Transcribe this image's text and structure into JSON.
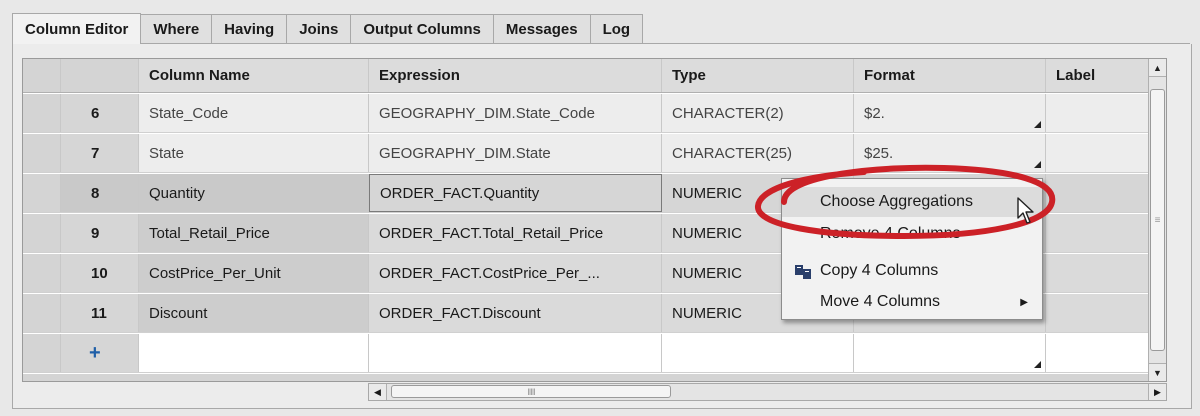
{
  "tabs": [
    {
      "label": "Column Editor",
      "active": true
    },
    {
      "label": "Where"
    },
    {
      "label": "Having"
    },
    {
      "label": "Joins"
    },
    {
      "label": "Output Columns"
    },
    {
      "label": "Messages"
    },
    {
      "label": "Log"
    }
  ],
  "grid": {
    "headers": [
      "",
      "Column Name",
      "Expression",
      "Type",
      "Format",
      "Label"
    ],
    "rows": [
      {
        "num": "6",
        "name": "State_Code",
        "expression": "GEOGRAPHY_DIM.State_Code",
        "type": "CHARACTER(2)",
        "format": "$2.",
        "label": ""
      },
      {
        "num": "7",
        "name": "State",
        "expression": "GEOGRAPHY_DIM.State",
        "type": "CHARACTER(25)",
        "format": "$25.",
        "label": ""
      },
      {
        "num": "8",
        "name": "Quantity",
        "expression": "ORDER_FACT.Quantity",
        "type": "NUMERIC",
        "format": "",
        "label": ""
      },
      {
        "num": "9",
        "name": "Total_Retail_Price",
        "expression": "ORDER_FACT.Total_Retail_Price",
        "type": "NUMERIC",
        "format": "",
        "label": ""
      },
      {
        "num": "10",
        "name": "CostPrice_Per_Unit",
        "expression": "ORDER_FACT.CostPrice_Per_...",
        "type": "NUMERIC",
        "format": "",
        "label": ""
      },
      {
        "num": "11",
        "name": "Discount",
        "expression": "ORDER_FACT.Discount",
        "type": "NUMERIC",
        "format": "",
        "label": ""
      }
    ],
    "add_row_symbol": "+"
  },
  "context_menu": {
    "items": [
      {
        "label": "Choose Aggregations",
        "highlighted": true
      },
      {
        "label": "Remove 4 Columns"
      },
      {
        "label": "Copy 4 Columns",
        "icon": "copy-icon"
      },
      {
        "label": "Move 4 Columns",
        "submenu": true
      }
    ]
  },
  "colors": {
    "highlight_ellipse": "#cc2127",
    "add_row_plus": "#1f5fa8"
  },
  "icons": {
    "scroll_up": "▲",
    "scroll_down": "▼",
    "scroll_left": "◀",
    "scroll_right": "▶",
    "submenu_arrow": "▶",
    "grip_vertical": "≡",
    "grip_horizontal": "IIIII"
  }
}
